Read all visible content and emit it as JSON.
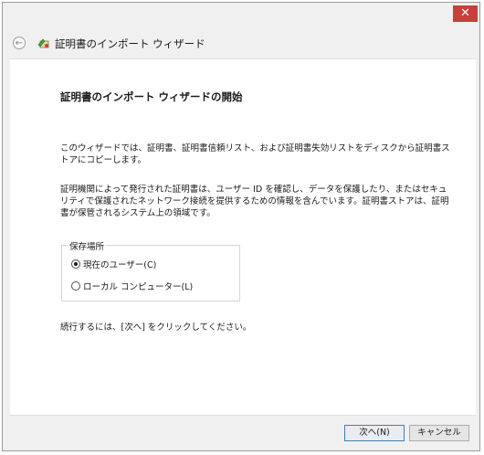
{
  "window": {
    "title": "証明書のインポート ウィザード",
    "close_label": "✕"
  },
  "header": {
    "back_glyph": "←",
    "title": "証明書のインポート ウィザード"
  },
  "main": {
    "heading": "証明書のインポート ウィザードの開始",
    "paragraph1": "このウィザードでは、証明書、証明書信頼リスト、および証明書失効リストをディスクから証明書ストアにコピーします。",
    "paragraph2": "証明機関によって発行された証明書は、ユーザー ID を確認し、データを保護したり、またはセキュリティで保護されたネットワーク接続を提供するための情報を含んでいます。証明書ストアは、証明書が保管されるシステム上の領域です。",
    "store_location": {
      "legend": "保存場所",
      "options": [
        {
          "label": "現在のユーザー(C)",
          "selected": true
        },
        {
          "label": "ローカル コンピューター(L)",
          "selected": false
        }
      ]
    },
    "continue_text": "続行するには、[次へ] をクリックしてください。"
  },
  "footer": {
    "next_label": "次へ(N)",
    "cancel_label": "キャンセル"
  },
  "colors": {
    "close_button": "#c7403a",
    "default_button_border": "#3c7fb1"
  }
}
